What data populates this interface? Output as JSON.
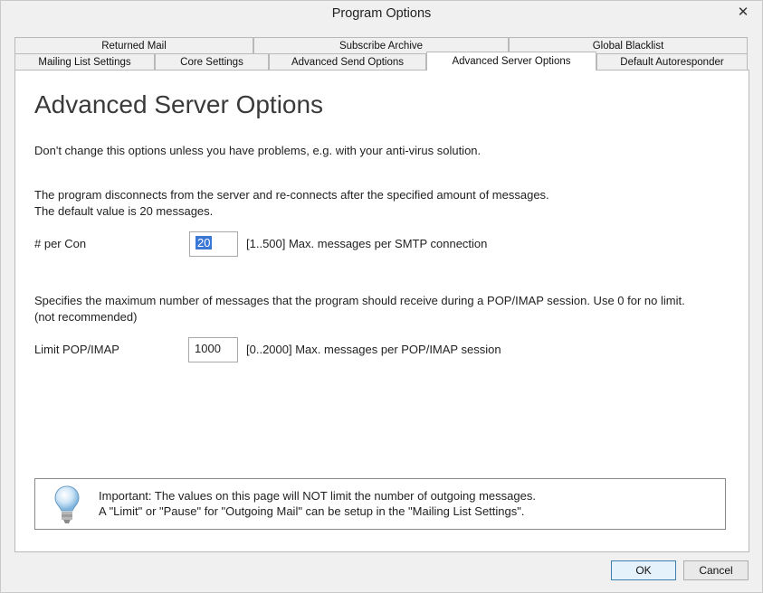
{
  "window": {
    "title": "Program Options"
  },
  "tabs": {
    "row1": [
      "Returned Mail",
      "Subscribe Archive",
      "Global Blacklist"
    ],
    "row2": [
      "Mailing List Settings",
      "Core Settings",
      "Advanced Send Options",
      "Advanced Server Options",
      "Default Autoresponder"
    ],
    "active": "Advanced Server Options"
  },
  "page": {
    "heading": "Advanced Server Options",
    "intro": "Don't change this options unless you have problems, e.g. with your anti-virus solution.",
    "disconnect_line1": "The program disconnects from the server and re-connects after the specified amount of messages.",
    "disconnect_line2": "The default value is 20 messages.",
    "per_con": {
      "label": "# per Con",
      "value": "20",
      "hint": "[1..500] Max. messages per SMTP connection"
    },
    "pop_line1": "Specifies the maximum number of messages that the program should receive during a POP/IMAP session. Use 0 for no limit.",
    "pop_line2": "(not recommended)",
    "pop_limit": {
      "label": "Limit POP/IMAP",
      "value": "1000",
      "hint": "[0..2000] Max. messages per POP/IMAP session"
    },
    "important_line1": "Important: The values on this page will NOT limit the number of outgoing messages.",
    "important_line2": "A \"Limit\" or \"Pause\" for \"Outgoing Mail\" can be setup in the \"Mailing List Settings\"."
  },
  "buttons": {
    "ok": "OK",
    "cancel": "Cancel"
  },
  "colors": {
    "accent": "#3b78d6",
    "window_bg": "#f0f0f0"
  },
  "icons": {
    "info": "lightbulb-icon",
    "close": "close-icon"
  }
}
